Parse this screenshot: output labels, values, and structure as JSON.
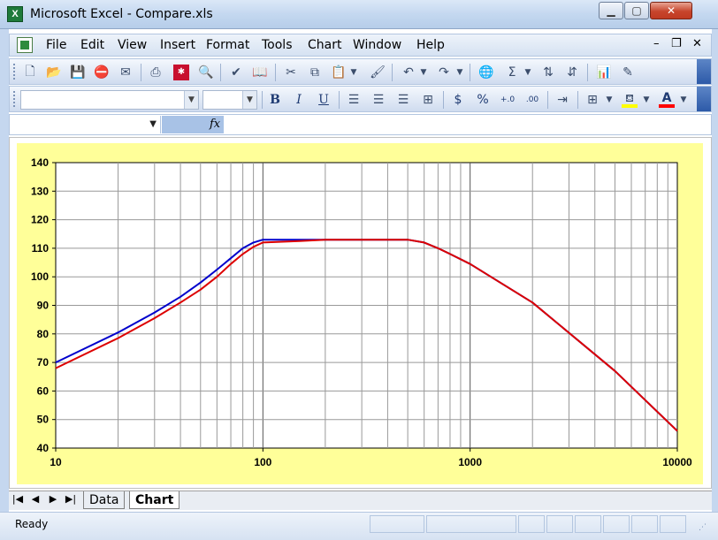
{
  "window": {
    "title": "Microsoft Excel - Compare.xls",
    "app_icon": "excel-icon",
    "controls": {
      "minimize": "minimize-icon",
      "maximize": "maximize-icon",
      "close": "close-icon"
    }
  },
  "menubar": {
    "items": [
      {
        "label": "File"
      },
      {
        "label": "Edit"
      },
      {
        "label": "View"
      },
      {
        "label": "Insert"
      },
      {
        "label": "Format"
      },
      {
        "label": "Tools"
      },
      {
        "label": "Chart"
      },
      {
        "label": "Window"
      },
      {
        "label": "Help"
      }
    ]
  },
  "toolbar_standard": {
    "icons": [
      "new-icon",
      "open-icon",
      "save-icon",
      "permission-icon",
      "email-icon",
      "print-icon",
      "research-icon",
      "print-preview-icon",
      "spelling-icon",
      "research-book-icon",
      "cut-icon",
      "copy-icon",
      "paste-icon",
      "format-painter-icon",
      "undo-icon",
      "redo-icon",
      "hyperlink-icon",
      "autosum-icon",
      "sort-ascending-icon",
      "sort-descending-icon",
      "chart-wizard-icon",
      "drawing-icon"
    ]
  },
  "toolbar_formatting": {
    "font_name": "",
    "font_size": "",
    "bold": "B",
    "italic": "I",
    "underline": "U",
    "currency": "$",
    "percent": "%",
    "increase_decimal": "+.0",
    "decrease_decimal": ".00",
    "colors": {
      "fill": "#ffff00",
      "font": "#ff0000"
    }
  },
  "formula_bar": {
    "name_box": "",
    "fx_label": "fx",
    "formula": ""
  },
  "chart_data": {
    "type": "line",
    "x_scale": "log",
    "xlim": [
      10,
      10000
    ],
    "ylim": [
      40,
      140
    ],
    "x_ticks": [
      "10",
      "100",
      "1000",
      "10000"
    ],
    "y_ticks": [
      "40",
      "50",
      "60",
      "70",
      "80",
      "90",
      "100",
      "110",
      "120",
      "130",
      "140"
    ],
    "grid": true,
    "title": "",
    "xlabel": "",
    "ylabel": "",
    "plot_background": "#ffffff",
    "chart_background": "#ffff99",
    "series": [
      {
        "color": "#0000cc",
        "x": [
          10,
          20,
          30,
          40,
          50,
          60,
          70,
          80,
          90,
          100,
          150,
          200,
          300,
          400,
          500,
          600,
          700,
          800,
          1000,
          2000,
          5000,
          10000
        ],
        "y": [
          70,
          80.5,
          87.5,
          93,
          98,
          102.5,
          106.5,
          110,
          112,
          113,
          113,
          113,
          113,
          113,
          113,
          112,
          110,
          108,
          104.5,
          91,
          67,
          46
        ]
      },
      {
        "color": "#dd0000",
        "x": [
          10,
          20,
          30,
          40,
          50,
          60,
          70,
          80,
          90,
          100,
          150,
          200,
          300,
          400,
          500,
          600,
          700,
          800,
          1000,
          2000,
          5000,
          10000
        ],
        "y": [
          68,
          78.5,
          85.5,
          91,
          95.5,
          100,
          104.5,
          108,
          110.5,
          112,
          112.5,
          113,
          113,
          113,
          113,
          112,
          110,
          108,
          104.5,
          91,
          67,
          46
        ]
      }
    ]
  },
  "sheet_tabs": {
    "nav": [
      "|◀",
      "◀",
      "▶",
      "▶|"
    ],
    "tabs": [
      {
        "label": "Data",
        "active": false
      },
      {
        "label": "Chart",
        "active": true
      }
    ]
  },
  "statusbar": {
    "status": "Ready"
  }
}
